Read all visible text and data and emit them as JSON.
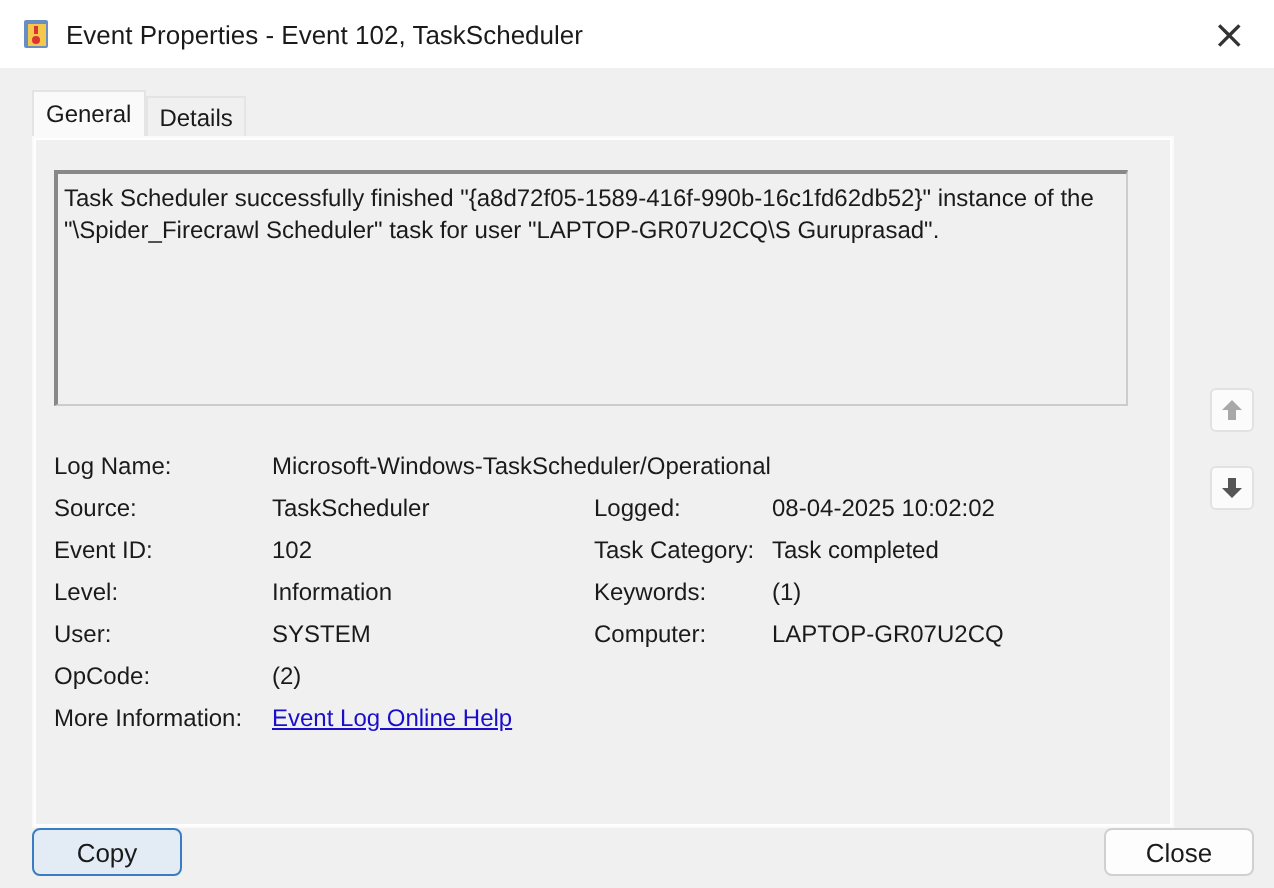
{
  "window": {
    "title": "Event Properties - Event 102, TaskScheduler",
    "close": "×"
  },
  "tabs": [
    {
      "label": "General",
      "selected": true
    },
    {
      "label": "Details",
      "selected": false
    }
  ],
  "description": "Task Scheduler successfully finished \"{a8d72f05-1589-416f-990b-16c1fd62db52}\" instance of the \"\\Spider_Firecrawl Scheduler\" task for user \"LAPTOP-GR07U2CQ\\S Guruprasad\".",
  "log_name": {
    "label": "Log Name:",
    "value": "Microsoft-Windows-TaskScheduler/Operational"
  },
  "fields": [
    {
      "label": "Source:",
      "value": "TaskScheduler",
      "label_2": "Logged:",
      "value_2": "08-04-2025 10:02:02"
    },
    {
      "label": "Event ID:",
      "value": "102",
      "label_2": "Task Category:",
      "value_2": "Task completed"
    },
    {
      "label": "Level:",
      "value": "Information",
      "label_2": "Keywords:",
      "value_2": "(1)"
    },
    {
      "label": "User:",
      "value": "SYSTEM",
      "label_2": "Computer:",
      "value_2": "LAPTOP-GR07U2CQ"
    },
    {
      "label": "OpCode:",
      "value": "(2)"
    }
  ],
  "more_information": {
    "label": "More Information:",
    "link": "Event Log Online Help"
  },
  "nav": {
    "previous_disabled": true,
    "next_disabled": false
  },
  "buttons": {
    "copy": "Copy",
    "close": "Close"
  }
}
